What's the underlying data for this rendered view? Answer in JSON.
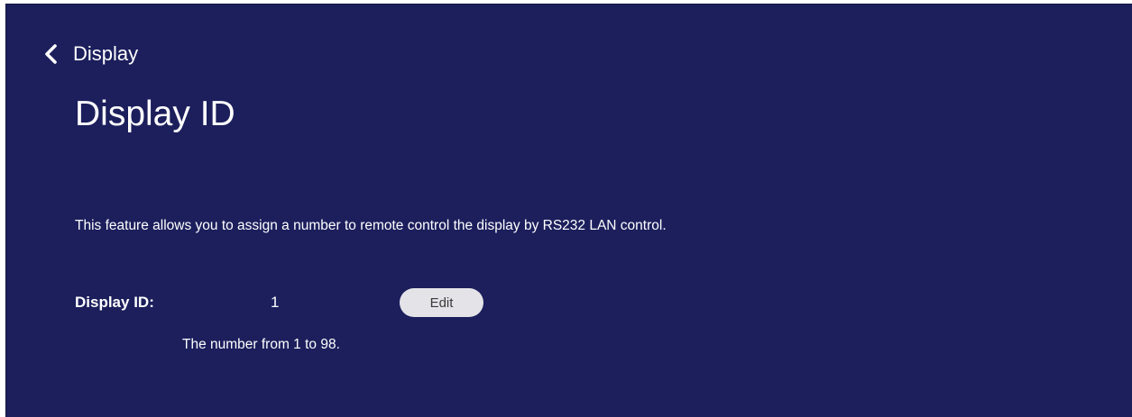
{
  "header": {
    "back_label": "Display",
    "back_icon": "chevron-left-icon"
  },
  "page": {
    "title": "Display ID",
    "description": "This feature allows you to assign a number to remote control the display by RS232 LAN control."
  },
  "display_id": {
    "label": "Display ID:",
    "value": "1",
    "edit_label": "Edit",
    "hint": "The number from 1 to 98."
  },
  "colors": {
    "background": "#1c1f5c",
    "text": "#ffffff",
    "button_bg": "#e4e4e8",
    "button_text": "#3a3a3a"
  }
}
